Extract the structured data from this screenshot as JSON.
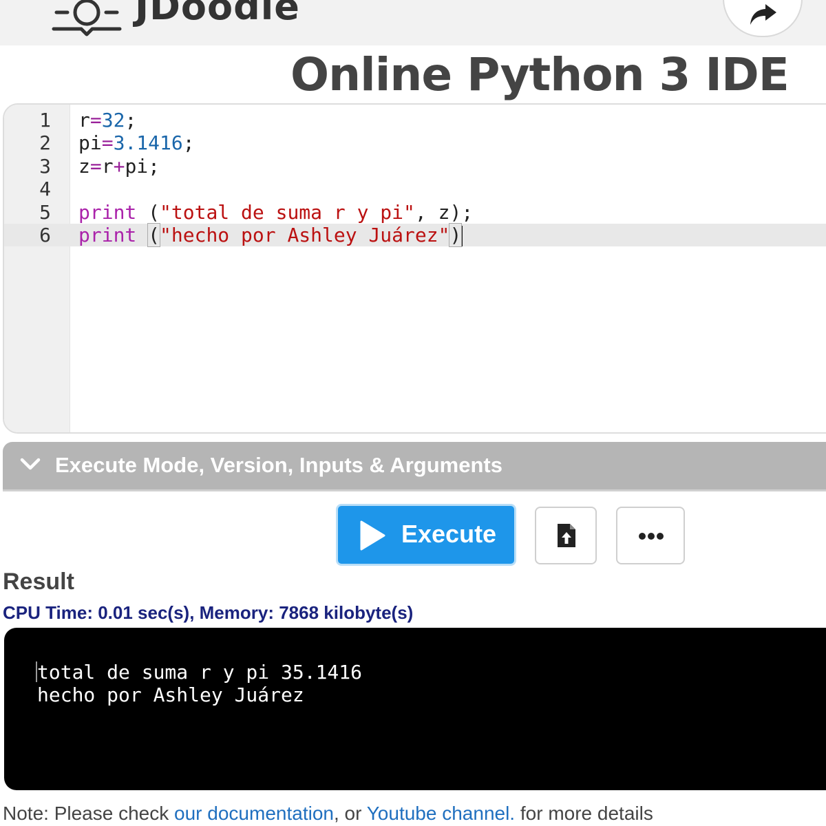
{
  "header": {
    "logo_text": "JDoodle",
    "logo_icon": "jdoodle-logo-icon",
    "share_icon": "share-arrow-icon"
  },
  "page_title": "Online Python 3 IDE",
  "editor": {
    "lines": [
      {
        "number": "1",
        "tokens": [
          [
            "r",
            "plain"
          ],
          [
            "=",
            "op"
          ],
          [
            "32",
            "num"
          ],
          [
            ";",
            "plain"
          ]
        ]
      },
      {
        "number": "2",
        "tokens": [
          [
            "pi",
            "plain"
          ],
          [
            "=",
            "op"
          ],
          [
            "3.1416",
            "num"
          ],
          [
            ";",
            "plain"
          ]
        ]
      },
      {
        "number": "3",
        "tokens": [
          [
            "z",
            "plain"
          ],
          [
            "=",
            "op"
          ],
          [
            "r",
            "plain"
          ],
          [
            "+",
            "op"
          ],
          [
            "pi",
            "plain"
          ],
          [
            ";",
            "plain"
          ]
        ]
      },
      {
        "number": "4",
        "tokens": []
      },
      {
        "number": "5",
        "tokens": [
          [
            "print",
            "kw"
          ],
          [
            " (",
            "plain"
          ],
          [
            "\"total de suma r y pi\"",
            "str"
          ],
          [
            ", z);",
            "plain"
          ]
        ]
      },
      {
        "number": "6",
        "tokens": [
          [
            "print",
            "kw"
          ],
          [
            " ",
            "plain"
          ],
          [
            "(",
            "bracket"
          ],
          [
            "\"hecho por Ashley Juárez\"",
            "str"
          ],
          [
            ")",
            "bracket"
          ]
        ],
        "active": true
      }
    ]
  },
  "execute_mode": {
    "label": "Execute Mode, Version, Inputs & Arguments"
  },
  "buttons": {
    "execute_label": "Execute"
  },
  "result": {
    "heading": "Result",
    "stats": "CPU Time: 0.01 sec(s), Memory: 7868 kilobyte(s)",
    "output_lines": [
      "total de suma r y pi 35.1416",
      "hecho por Ashley Juárez"
    ]
  },
  "footer": {
    "prefix": "Note: Please check ",
    "doc_link": "our documentation",
    "middle": ", or ",
    "youtube_link": "Youtube channel.",
    "suffix": " for more details"
  },
  "colors": {
    "execute_button": "#1e96ea",
    "mode_bar": "#b5b5b5",
    "stats_text": "#1a237e",
    "link": "#1f6fbf"
  }
}
